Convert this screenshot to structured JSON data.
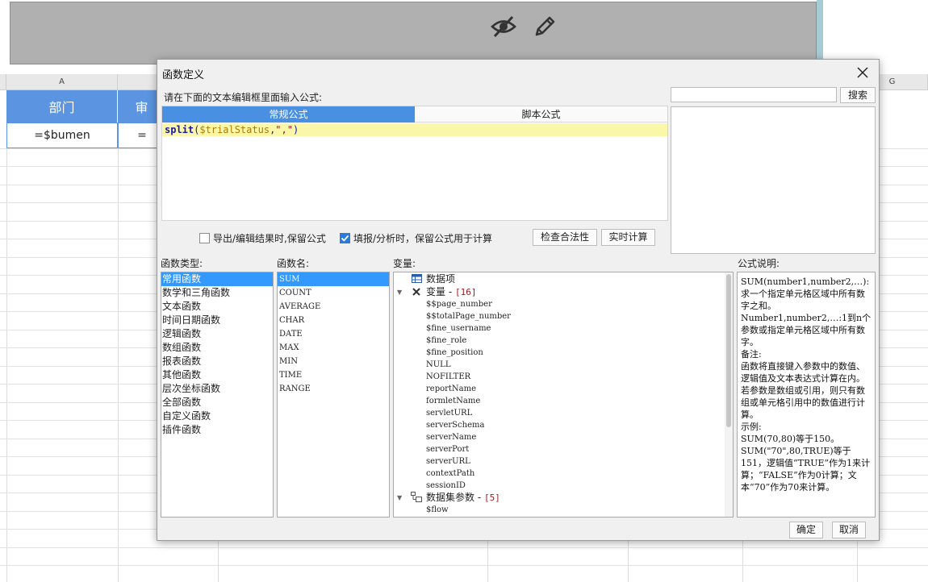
{
  "sheet": {
    "columns": [
      {
        "label": "A"
      },
      {
        "label": ""
      },
      {
        "label": ""
      },
      {
        "label": ""
      },
      {
        "label": ""
      },
      {
        "label": ""
      },
      {
        "label": ""
      },
      {
        "label": "G"
      }
    ],
    "header_cells": [
      "部门",
      "审"
    ],
    "value_cells": [
      "=$bumen",
      "="
    ]
  },
  "dialog": {
    "title": "函数定义",
    "prompt": "请在下面的文本编辑框里面输入公式:",
    "tabs": [
      {
        "label": "常规公式"
      },
      {
        "label": "脚本公式"
      }
    ],
    "code": {
      "fn": "split",
      "open": "(",
      "var": "$trialStatus",
      "comma": ",",
      "str": "\",\"",
      "close": ")"
    },
    "search": {
      "value": "",
      "placeholder": "",
      "button": "搜索"
    },
    "options": {
      "keep_on_export": {
        "label": "导出/编辑结果时,保留公式",
        "checked": false
      },
      "keep_on_fill": {
        "label": "填报/分析时，保留公式用于计算",
        "checked": true
      }
    },
    "buttons": {
      "validate": "检查合法性",
      "realtime": "实时计算",
      "ok": "确定",
      "cancel": "取消"
    },
    "sections": {
      "types": "函数类型:",
      "names": "函数名:",
      "variables": "变量:",
      "help": "公式说明:"
    },
    "function_types": [
      "常用函数",
      "数学和三角函数",
      "文本函数",
      "时间日期函数",
      "逻辑函数",
      "数组函数",
      "报表函数",
      "其他函数",
      "层次坐标函数",
      "全部函数",
      "自定义函数",
      "插件函数"
    ],
    "function_names": [
      "SUM",
      "COUNT",
      "AVERAGE",
      "CHAR",
      "DATE",
      "MAX",
      "MIN",
      "TIME",
      "RANGE"
    ],
    "variables": {
      "data_items": "数据项",
      "vars_label": "变量 - ",
      "vars_count": "[16]",
      "vars": [
        "$$page_number",
        "$$totalPage_number",
        "$fine_username",
        "$fine_role",
        "$fine_position",
        "NULL",
        "NOFILTER",
        "reportName",
        "formletName",
        "servletURL",
        "serverSchema",
        "serverName",
        "serverPort",
        "serverURL",
        "contextPath",
        "sessionID"
      ],
      "dataset_label": "数据集参数 - ",
      "dataset_count": "[5]",
      "dataset_vars": [
        "$flow"
      ]
    },
    "help_lines": [
      "SUM(number1,number2,…):求一个指定单元格区域中所有数字之和。",
      "Number1,number2,…:1到n个参数或指定单元格区域中所有数字。",
      "备注:",
      "函数将直接键入参数中的数值、逻辑值及文本表达式计算在内。若参数是数组或引用，则只有数组或单元格引用中的数值进行计算。",
      "示例:",
      "SUM(70,80)等于150。",
      "SUM(\"70\",80,TRUE)等于151，逻辑值“TRUE”作为1来计算；“FALSE”作为0计算；文本“70”作为70来计算。"
    ]
  },
  "colors": {
    "accent": "#4a90e2",
    "header_cell": "#5b94e0",
    "selection": "#3399ff",
    "code_highlight": "#fbf7a8"
  }
}
